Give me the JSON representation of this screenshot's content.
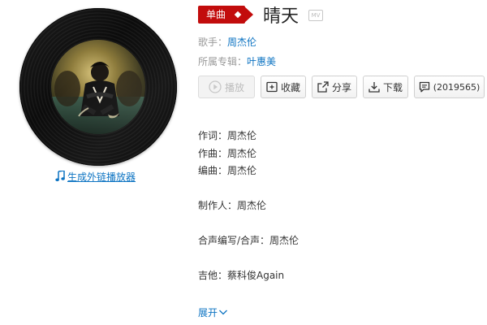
{
  "song": {
    "badge_label": "单曲",
    "title": "晴天",
    "mv_label": "MV"
  },
  "meta": {
    "singer_label": "歌手：",
    "singer_name": "周杰伦",
    "album_label": "所属专辑：",
    "album_name": "叶惠美"
  },
  "actions": {
    "play_label": "播放",
    "collect_label": "收藏",
    "share_label": "分享",
    "download_label": "下载",
    "comment_label": "(2019565)"
  },
  "left": {
    "external_player_label": "生成外链播放器"
  },
  "credits": [
    "作词：周杰伦",
    "作曲：周杰伦",
    "编曲：周杰伦",
    "制作人：周杰伦",
    "合声编写/合声：周杰伦",
    "吉他：蔡科俊Again"
  ],
  "expand_label": "展开",
  "colors": {
    "accent_red": "#c20c0c",
    "link_blue": "#0c73c2",
    "muted_gray": "#999999"
  },
  "icons": {
    "play_button": "play-circle-icon",
    "collect_button": "folder-plus-icon",
    "share_button": "share-icon",
    "download_button": "download-icon",
    "comment_button": "comment-icon",
    "external_player": "music-note-icon",
    "expand": "chevron-down-icon"
  }
}
